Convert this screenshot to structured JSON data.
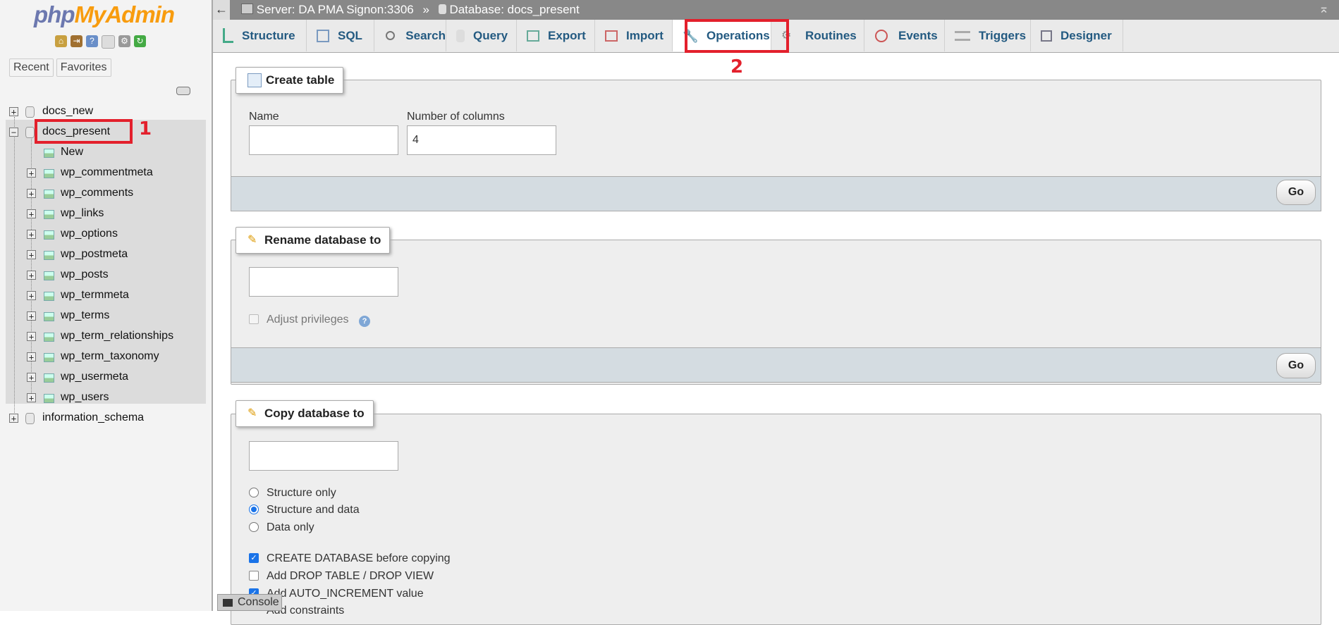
{
  "app": {
    "logo_part1": "php",
    "logo_part2": "MyAdmin"
  },
  "sidebar": {
    "nav_tabs": [
      "Recent",
      "Favorites"
    ],
    "tree": [
      {
        "label": "docs_new",
        "type": "db",
        "expanded": false
      },
      {
        "label": "docs_present",
        "type": "db",
        "expanded": true
      },
      {
        "label": "New",
        "type": "new"
      },
      {
        "label": "wp_commentmeta",
        "type": "table"
      },
      {
        "label": "wp_comments",
        "type": "table"
      },
      {
        "label": "wp_links",
        "type": "table"
      },
      {
        "label": "wp_options",
        "type": "table"
      },
      {
        "label": "wp_postmeta",
        "type": "table"
      },
      {
        "label": "wp_posts",
        "type": "table"
      },
      {
        "label": "wp_termmeta",
        "type": "table"
      },
      {
        "label": "wp_terms",
        "type": "table"
      },
      {
        "label": "wp_term_relationships",
        "type": "table"
      },
      {
        "label": "wp_term_taxonomy",
        "type": "table"
      },
      {
        "label": "wp_usermeta",
        "type": "table"
      },
      {
        "label": "wp_users",
        "type": "table"
      },
      {
        "label": "information_schema",
        "type": "db",
        "expanded": false
      }
    ]
  },
  "breadcrumb": {
    "server": "Server: DA PMA Signon:3306",
    "separator": "»",
    "database": "Database: docs_present"
  },
  "tabs": [
    {
      "label": "Structure"
    },
    {
      "label": "SQL"
    },
    {
      "label": "Search"
    },
    {
      "label": "Query"
    },
    {
      "label": "Export"
    },
    {
      "label": "Import"
    },
    {
      "label": "Operations"
    },
    {
      "label": "Routines"
    },
    {
      "label": "Events"
    },
    {
      "label": "Triggers"
    },
    {
      "label": "Designer"
    }
  ],
  "annotations": {
    "a1": "1",
    "a2": "2"
  },
  "create_table": {
    "legend": "Create table",
    "name_label": "Name",
    "name_value": "",
    "columns_label": "Number of columns",
    "columns_value": "4",
    "go": "Go"
  },
  "rename_db": {
    "legend": "Rename database to",
    "value": "",
    "adjust_privileges": "Adjust privileges",
    "help": "?",
    "go": "Go"
  },
  "copy_db": {
    "legend": "Copy database to",
    "value": "",
    "radio_options": [
      "Structure only",
      "Structure and data",
      "Data only"
    ],
    "selected_radio": "Structure and data",
    "checkboxes": [
      {
        "label": "CREATE DATABASE before copying",
        "checked": true
      },
      {
        "label": "Add DROP TABLE / DROP VIEW",
        "checked": false
      },
      {
        "label": "Add AUTO_INCREMENT value",
        "checked": true
      },
      {
        "label": "Add constraints",
        "checked": false
      }
    ]
  },
  "console": {
    "label": "Console"
  },
  "colors": {
    "link": "#235a81",
    "highlight": "#e3202c",
    "logo_php": "#6c78af",
    "logo_myadmin": "#f89c0e"
  }
}
